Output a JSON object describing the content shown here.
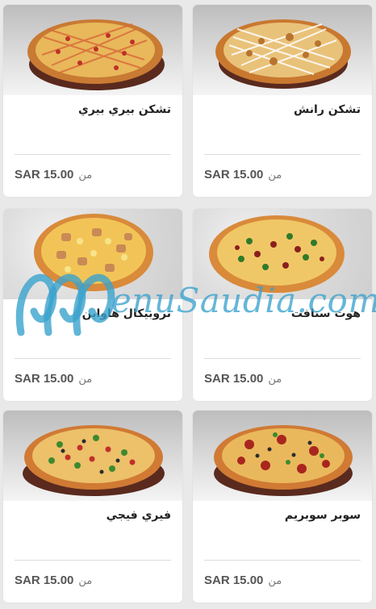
{
  "items": [
    {
      "name": "تشكن رانش",
      "price": "SAR 15.00",
      "from": "من"
    },
    {
      "name": "تشكن بيري بيري",
      "price": "SAR 15.00",
      "from": "من"
    },
    {
      "name": "هوت ستافت",
      "price": "SAR 15.00",
      "from": "من"
    },
    {
      "name": "تروبيكال هاواين",
      "price": "SAR 15.00",
      "from": "من"
    },
    {
      "name": "سوبر سوبريم",
      "price": "SAR 15.00",
      "from": "من"
    },
    {
      "name": "فيري فيجي",
      "price": "SAR 15.00",
      "from": "من"
    }
  ],
  "watermark": {
    "text": "enuSaudia.com",
    "color": "#3aa2cd"
  }
}
